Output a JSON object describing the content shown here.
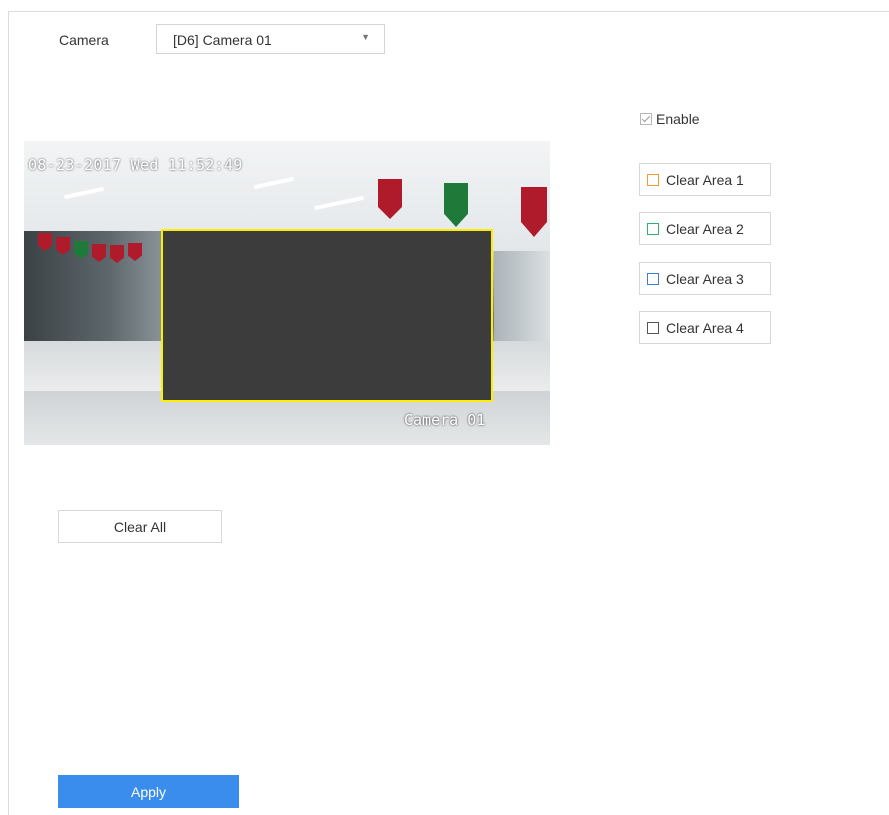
{
  "camera": {
    "label": "Camera",
    "selected": "[D6] Camera 01"
  },
  "preview": {
    "timestamp": "08-23-2017 Wed 11:52:49",
    "channel_name": "Camera 01",
    "mask_border_color": "#ffee00"
  },
  "enable": {
    "label": "Enable",
    "checked": true
  },
  "areas": [
    {
      "label": "Clear Area 1",
      "color": "#f0a030"
    },
    {
      "label": "Clear Area 2",
      "color": "#2db36b"
    },
    {
      "label": "Clear Area 3",
      "color": "#3b7ddd"
    },
    {
      "label": "Clear Area 4",
      "color": "#555555"
    }
  ],
  "buttons": {
    "clear_all": "Clear All",
    "apply": "Apply"
  }
}
